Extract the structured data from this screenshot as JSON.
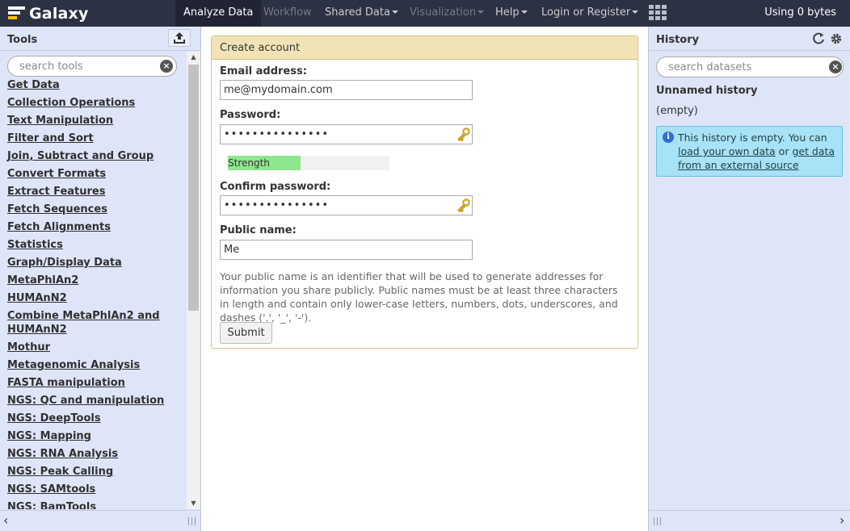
{
  "masthead": {
    "brand": "Galaxy",
    "nav": [
      {
        "label": "Analyze Data",
        "state": "active",
        "caret": false
      },
      {
        "label": "Workflow",
        "state": "disabled",
        "caret": false
      },
      {
        "label": "Shared Data",
        "state": "normal",
        "caret": true
      },
      {
        "label": "Visualization",
        "state": "disabled",
        "caret": true
      },
      {
        "label": "Help",
        "state": "normal",
        "caret": true
      },
      {
        "label": "Login or Register",
        "state": "normal",
        "caret": true
      }
    ],
    "usage": "Using 0 bytes",
    "colors": {
      "background": "#2c3143",
      "active": "#212434",
      "brand_accent": "#f7c400"
    }
  },
  "tools": {
    "title": "Tools",
    "search_placeholder": "search tools",
    "items": [
      "Get Data",
      "Collection Operations",
      "Text Manipulation",
      "Filter and Sort",
      "Join, Subtract and Group",
      "Convert Formats",
      "Extract Features",
      "Fetch Sequences",
      "Fetch Alignments",
      "Statistics",
      "Graph/Display Data",
      "MetaPhlAn2",
      "HUMAnN2",
      "Combine MetaPhlAn2 and HUMAnN2",
      "Mothur",
      "Metagenomic Analysis",
      "FASTA manipulation",
      "NGS: QC and manipulation",
      "NGS: DeepTools",
      "NGS: Mapping",
      "NGS: RNA Analysis",
      "NGS: Peak Calling",
      "NGS: SAMtools",
      "NGS: BamTools"
    ]
  },
  "form": {
    "title": "Create account",
    "email_label": "Email address:",
    "email_value": "me@mydomain.com",
    "password_label": "Password:",
    "password_value": "•••••••••••••••",
    "strength_label": "Strength",
    "strength_fraction": 0.45,
    "confirm_label": "Confirm password:",
    "confirm_value": "•••••••••••••••",
    "public_name_label": "Public name:",
    "public_name_value": "Me",
    "help": "Your public name is an identifier that will be used to generate addresses for information you share publicly. Public names must be at least three characters in length and contain only lower-case letters, numbers, dots, underscores, and dashes ('.', '_', '-').",
    "submit_label": "Submit"
  },
  "history": {
    "title": "History",
    "search_placeholder": "search datasets",
    "name": "Unnamed history",
    "empty_text": "(empty)",
    "info_prefix": "This history is empty. You can ",
    "info_link1": "load your own data",
    "info_middle": " or ",
    "info_link2": "get data from an external source"
  }
}
